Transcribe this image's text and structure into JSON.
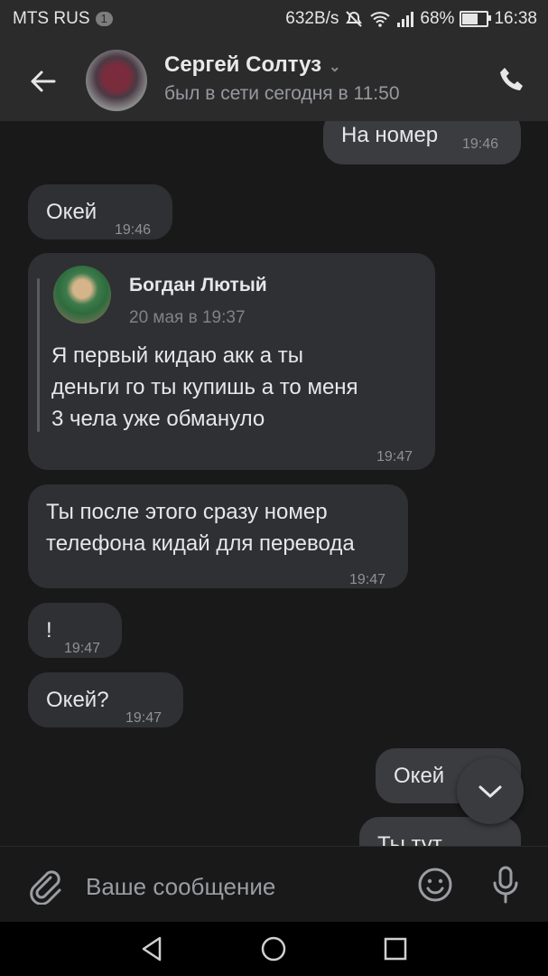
{
  "status_bar": {
    "carrier": "MTS RUS",
    "notification_count": "1",
    "net_speed": "632B/s",
    "battery_percent": "68%",
    "battery_level": 0.68,
    "clock": "16:38"
  },
  "header": {
    "contact_name": "Сергей Солтуз",
    "last_seen": "был в сети сегодня в 11:50",
    "icons": [
      "back-arrow-icon",
      "chevron-down-icon",
      "phone-icon"
    ]
  },
  "messages": [
    {
      "dir": "out",
      "text": "На номер",
      "time": "19:46"
    },
    {
      "dir": "in",
      "text": "Окей",
      "time": "19:46"
    },
    {
      "dir": "in",
      "type": "forwarded",
      "author": "Богдан Лютый",
      "date": "20 мая в 19:37",
      "text": "Я первый кидаю акк а ты\nденьги го ты купишь а то меня\n3 чела уже обмануло",
      "time": "19:47"
    },
    {
      "dir": "in",
      "text": "Ты после этого сразу номер\nтелефона кидай для перевода",
      "time": "19:47"
    },
    {
      "dir": "in",
      "text": "!",
      "time": "19:47"
    },
    {
      "dir": "in",
      "text": "Окей?",
      "time": "19:47"
    },
    {
      "dir": "out",
      "text": "Окей",
      "time": ""
    },
    {
      "dir": "out",
      "text": "Ты тут",
      "time": ""
    }
  ],
  "composer": {
    "placeholder": "Ваше сообщение",
    "value": "",
    "icons": [
      "paperclip-icon",
      "emoji-icon",
      "microphone-icon"
    ]
  },
  "navigation": {
    "icons": [
      "back-triangle-icon",
      "home-circle-icon",
      "recents-square-icon"
    ]
  },
  "colors": {
    "background": "#19191a",
    "header": "#2b2b2c",
    "bubble_in": "#2f3033",
    "bubble_out": "#3b3c3f",
    "text": "#e6e7e9",
    "muted": "#8e9196"
  }
}
